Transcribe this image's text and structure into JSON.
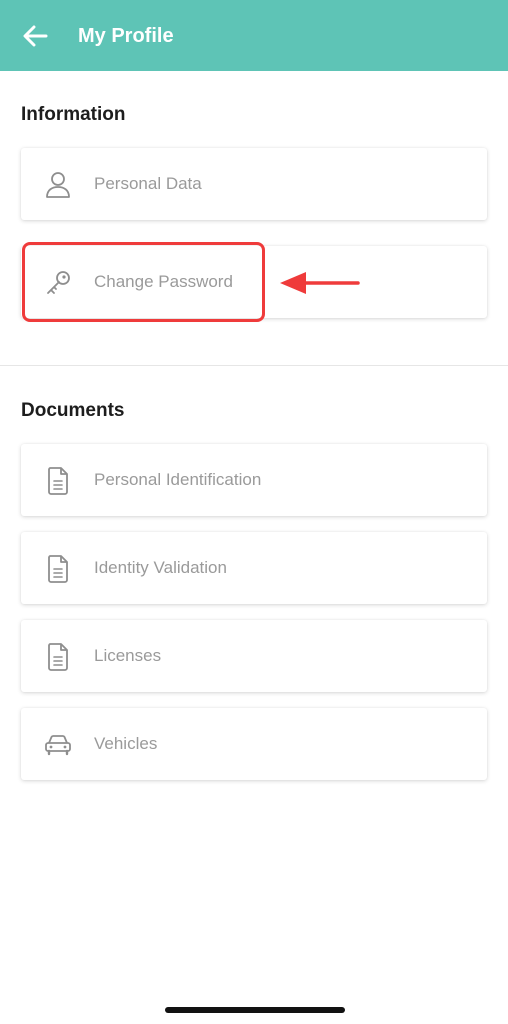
{
  "header": {
    "title": "My Profile",
    "back_icon": "arrow-left-icon",
    "background_color": "#5ec4b6"
  },
  "information": {
    "heading": "Information",
    "items": [
      {
        "label": "Personal Data",
        "icon": "person-icon"
      },
      {
        "label": "Change Password",
        "icon": "key-icon"
      }
    ]
  },
  "documents": {
    "heading": "Documents",
    "items": [
      {
        "label": "Personal Identification",
        "icon": "document-icon"
      },
      {
        "label": "Identity Validation",
        "icon": "document-icon"
      },
      {
        "label": "Licenses",
        "icon": "document-icon"
      },
      {
        "label": "Vehicles",
        "icon": "car-icon"
      }
    ]
  },
  "annotation": {
    "highlight_color": "#ef3b3b",
    "target": "Change Password"
  }
}
